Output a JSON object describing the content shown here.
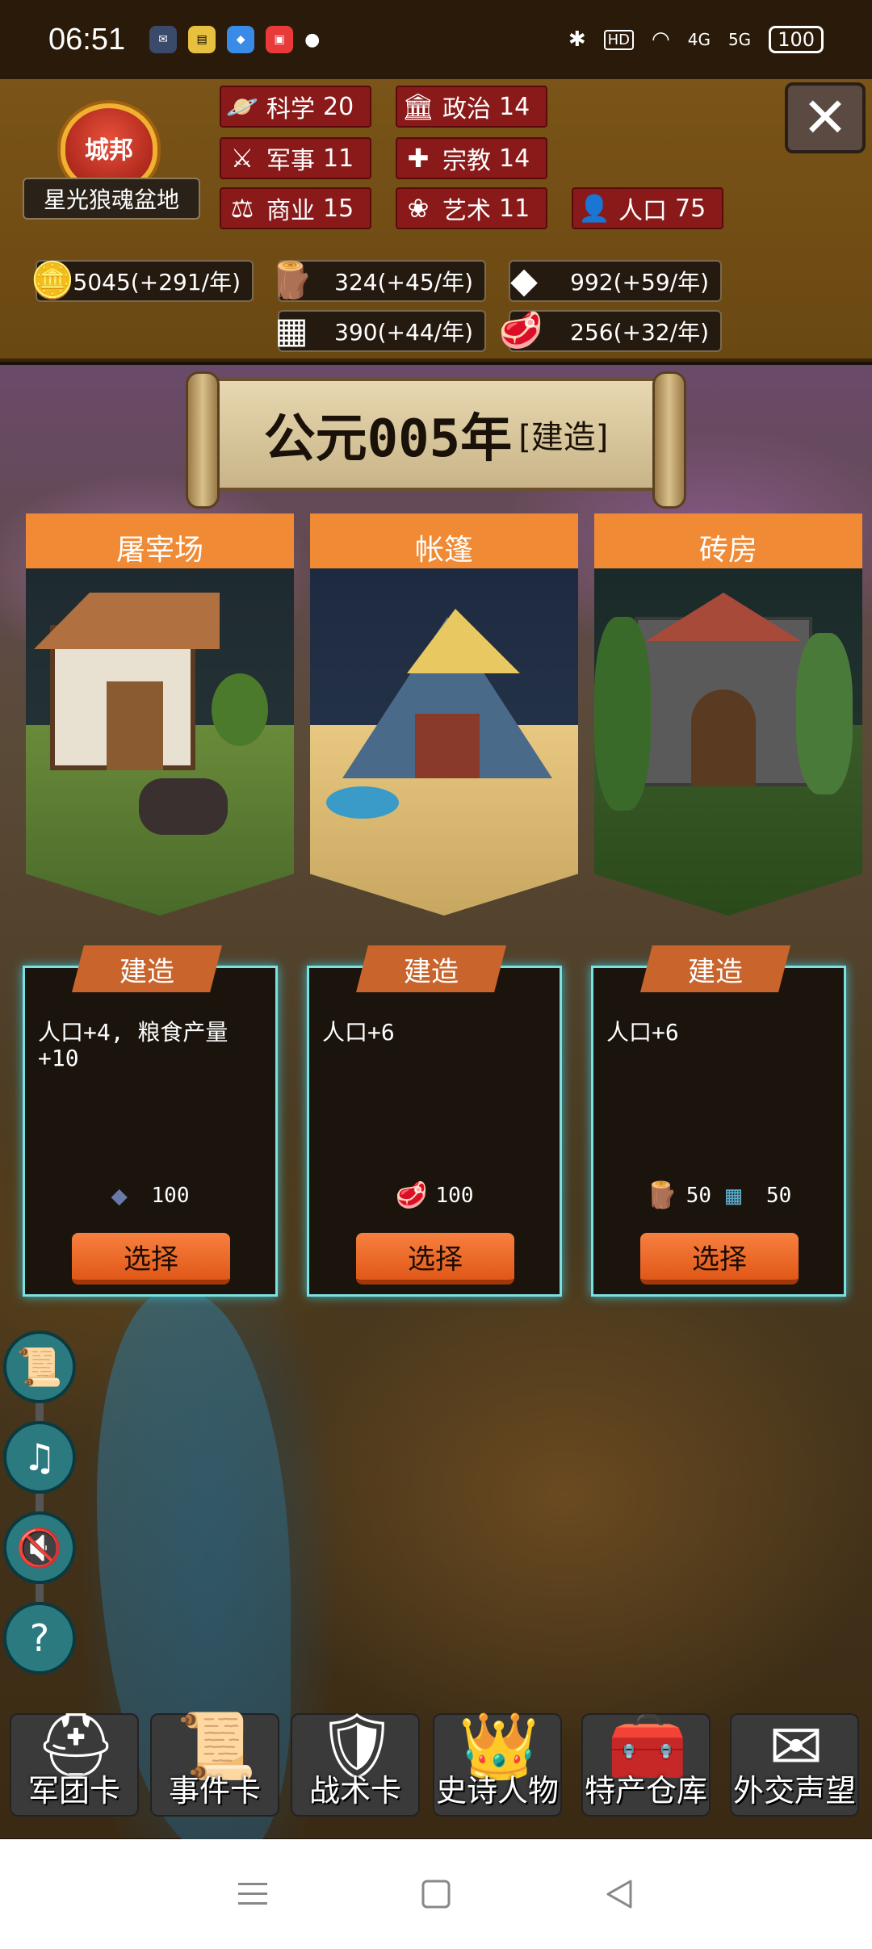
{
  "status_bar": {
    "time": "06:51",
    "battery": "100",
    "network_4g": "4G",
    "network_5g": "5G",
    "hd": "HD"
  },
  "city": {
    "type": "城邦",
    "name": "星光狼魂盆地"
  },
  "stats": {
    "science": {
      "label": "科学",
      "value": "20"
    },
    "politics": {
      "label": "政治",
      "value": "14"
    },
    "military": {
      "label": "军事",
      "value": "11"
    },
    "religion": {
      "label": "宗教",
      "value": "14"
    },
    "commerce": {
      "label": "商业",
      "value": "15"
    },
    "art": {
      "label": "艺术",
      "value": "11"
    },
    "population": {
      "label": "人口",
      "value": "75"
    }
  },
  "resources": {
    "gold": "5045(+291/年)",
    "wood": "324(+45/年)",
    "ore": "992(+59/年)",
    "tech": "390(+44/年)",
    "food": "256(+32/年)"
  },
  "banner": {
    "year": "公元005年",
    "phase": "[建造]"
  },
  "cards": [
    {
      "title": "屠宰场",
      "tag": "建造",
      "effect": "人口+4, 粮食产量+10",
      "costs": [
        {
          "icon": "ore-icon",
          "amount": "100"
        }
      ],
      "button": "选择"
    },
    {
      "title": "帐篷",
      "tag": "建造",
      "effect": "人口+6",
      "costs": [
        {
          "icon": "meat-icon",
          "amount": "100"
        }
      ],
      "button": "选择"
    },
    {
      "title": "砖房",
      "tag": "建造",
      "effect": "人口+6",
      "costs": [
        {
          "icon": "wood-icon",
          "amount": "50"
        },
        {
          "icon": "tech-icon",
          "amount": "50"
        }
      ],
      "button": "选择"
    }
  ],
  "tabs": [
    {
      "label": "军团卡",
      "icon": "helmet-icon"
    },
    {
      "label": "事件卡",
      "icon": "scroll-icon"
    },
    {
      "label": "战术卡",
      "icon": "shield-icon"
    },
    {
      "label": "史诗人物",
      "icon": "crown-icon"
    },
    {
      "label": "特产仓库",
      "icon": "chest-icon"
    },
    {
      "label": "外交声望",
      "icon": "letter-icon"
    }
  ],
  "fab_icons": [
    "log-icon",
    "music-off-icon",
    "sound-off-icon",
    "help-icon"
  ],
  "colors": {
    "header_bg": "#7a5418",
    "stat_bg": "#8a1a1a",
    "card_title": "#f08a34",
    "card_border": "#7ae0e0",
    "select_button": "#f08040",
    "fab_bg": "#2a7a80"
  }
}
